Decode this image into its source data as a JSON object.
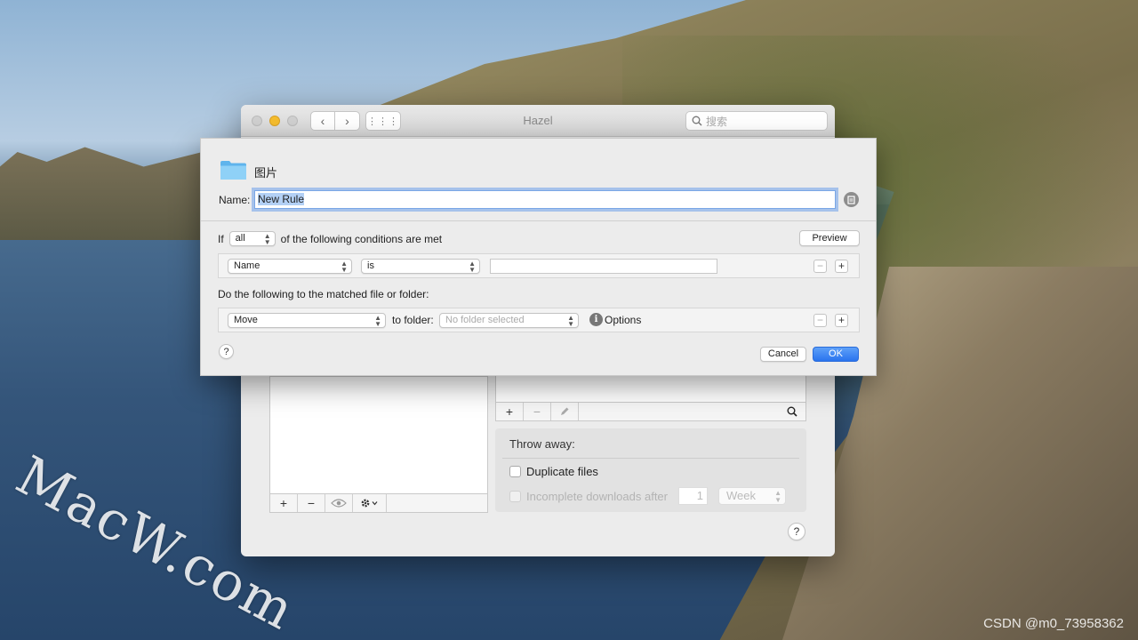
{
  "window": {
    "title": "Hazel"
  },
  "toolbar": {
    "search_placeholder": "搜索",
    "back_icon": "‹",
    "forward_icon": "›",
    "grid_icon": "⋮⋮⋮"
  },
  "rule_sheet": {
    "folder_name": "图片",
    "name_label": "Name:",
    "name_value": "New Rule",
    "if_label": "If",
    "match_mode": "all",
    "conditions_text": "of the following conditions are met",
    "preview_label": "Preview",
    "condition": {
      "attribute": "Name",
      "operator": "is",
      "value": ""
    },
    "actions_text": "Do the following to the matched file or folder:",
    "action": {
      "type": "Move",
      "to_folder_label": "to folder:",
      "folder_placeholder": "No folder selected",
      "options_label": "Options"
    },
    "help_label": "?",
    "cancel_label": "Cancel",
    "ok_label": "OK"
  },
  "throw_away": {
    "title": "Throw away:",
    "duplicate_files_label": "Duplicate files",
    "incomplete_downloads_label": "Incomplete downloads after",
    "incomplete_value": "1",
    "incomplete_unit": "Week"
  },
  "bottom_help": "?",
  "watermark": "MacW.com",
  "credit": "CSDN @m0_73958362",
  "colors": {
    "accent": "#2a74ee",
    "focus_ring": "#7aa7e6",
    "minimize": "#f5bd2e"
  }
}
